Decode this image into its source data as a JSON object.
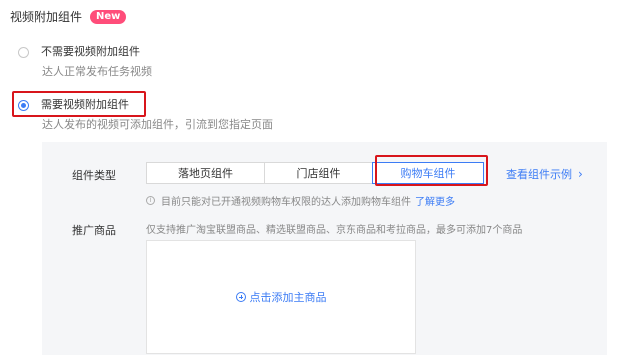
{
  "header": {
    "title": "视频附加组件",
    "badge": "New"
  },
  "options": [
    {
      "label": "不需要视频附加组件",
      "description": "达人正常发布任务视频",
      "selected": false
    },
    {
      "label": "需要视频附加组件",
      "description": "达人发布的视频可添加组件，引流到您指定页面",
      "selected": true
    }
  ],
  "component": {
    "label": "组件类型",
    "types": [
      "落地页组件",
      "门店组件",
      "购物车组件"
    ],
    "selected": "购物车组件",
    "example_link": "查看组件示例",
    "notice": "目前只能对已开通视频购物车权限的达人添加购物车组件",
    "learn_more": "了解更多"
  },
  "promotion": {
    "label": "推广商品",
    "hint": "仅支持推广淘宝联盟商品、精选联盟商品、京东商品和考拉商品，最多可添加7个商品",
    "add_label": "点击添加主商品"
  },
  "colors": {
    "accent": "#3c7cf5",
    "highlight": "#d8151b",
    "badge": "#ff4d7a"
  }
}
